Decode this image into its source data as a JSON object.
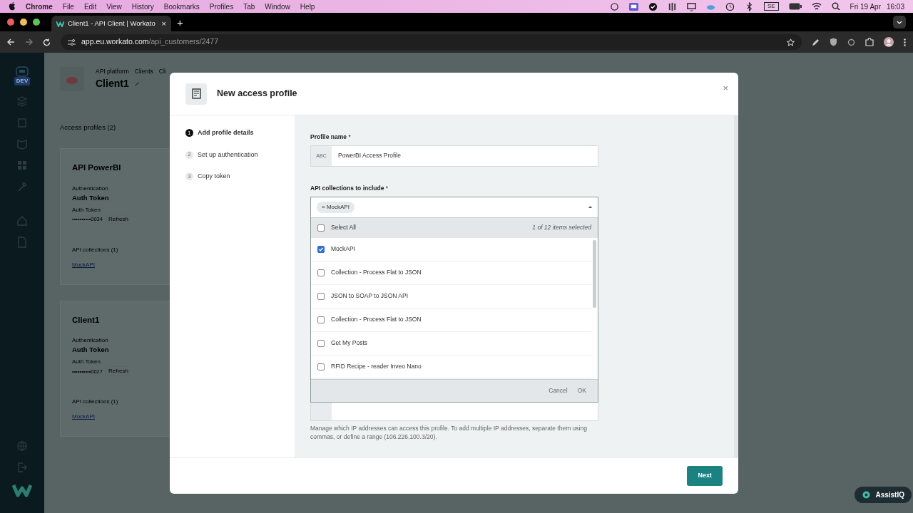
{
  "menubar": {
    "app": "Chrome",
    "items": [
      "File",
      "Edit",
      "View",
      "History",
      "Bookmarks",
      "Profiles",
      "Tab",
      "Window",
      "Help"
    ],
    "input_source": "SE",
    "date": "Fri 19 Apr",
    "time": "16:03"
  },
  "browser": {
    "tab": {
      "title": "Client1 - API Client | Workato",
      "close": "×"
    },
    "new_tab": "+",
    "url": {
      "host": "app.eu.workato.com",
      "path": "/api_customers/2477"
    }
  },
  "page": {
    "sidebar_badge": "DEV",
    "breadcrumb": [
      "API platform",
      "Clients",
      "Cli"
    ],
    "title": "Client1",
    "section_title": "Access profiles (2)",
    "profiles": [
      {
        "name": "API PowerBI",
        "auth_label": "Authentication",
        "auth": "Auth Token",
        "token_label": "Auth Token",
        "token": "••••••••••0034",
        "refresh": "Refresh",
        "collections_label": "API collections (1)",
        "collection": "MockAPI"
      },
      {
        "name": "Client1",
        "auth_label": "Authentication",
        "auth": "Auth Token",
        "token_label": "Auth Token",
        "token": "••••••••••0027",
        "refresh": "Refresh",
        "collections_label": "API collections (1)",
        "collection": "MockAPI"
      }
    ]
  },
  "modal": {
    "title": "New access profile",
    "close": "×",
    "steps": [
      {
        "number": "1",
        "label": "Add profile details",
        "selected": true
      },
      {
        "number": "2",
        "label": "Set up authentication",
        "selected": false
      },
      {
        "number": "3",
        "label": "Copy token",
        "selected": false
      }
    ],
    "profile_name": {
      "label": "Profile name",
      "required_mark": "*",
      "prefix": "ABC",
      "value": "PowerBI Access Profile"
    },
    "collections": {
      "label": "API collections to include",
      "required_mark": "*",
      "expanded": true,
      "chips": [
        {
          "label": "MockAPI",
          "remove": "×"
        }
      ],
      "select_all": {
        "label": "Select All",
        "checked": false
      },
      "count": "1 of 12 items selected",
      "options": [
        {
          "label": "MockAPI",
          "checked": true
        },
        {
          "label": "Collection - Process Flat to JSON",
          "checked": false
        },
        {
          "label": "JSON to SOAP to JSON API",
          "checked": false
        },
        {
          "label": "Collection - Process Flat to JSON",
          "checked": false
        },
        {
          "label": "Get My Posts",
          "checked": false
        },
        {
          "label": "RFID Recipe - reader Inveo Nano",
          "checked": false
        }
      ],
      "cancel": "Cancel",
      "ok": "OK"
    },
    "ip_hint": "Manage which IP addresses can access this profile. To add multiple IP addresses, separate them using commas, or define a range (106.226.100.3/20).",
    "next": "Next"
  },
  "assistant": {
    "label": "AssistIQ"
  }
}
